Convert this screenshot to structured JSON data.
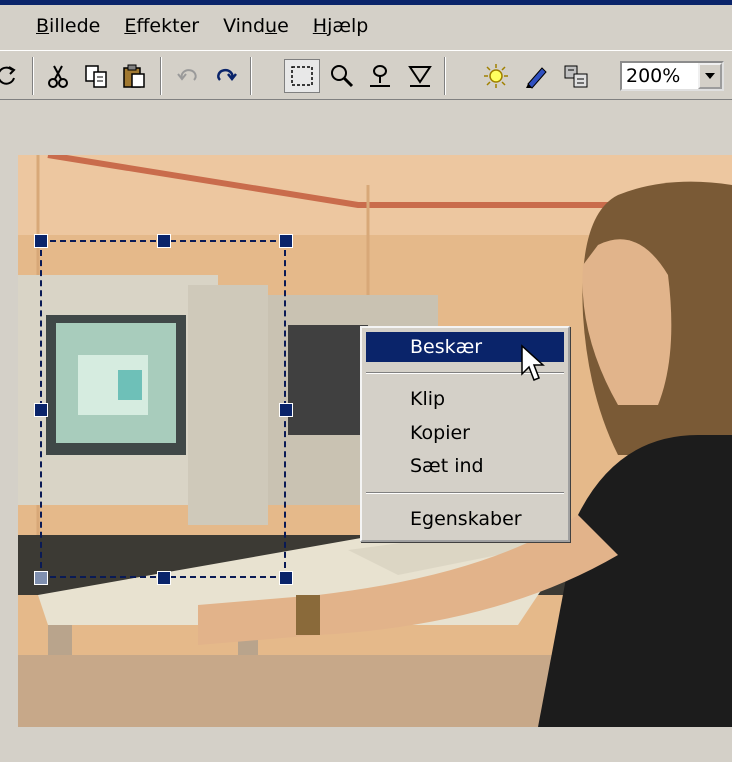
{
  "menubar": {
    "items": [
      {
        "label": "Billede",
        "u": "B",
        "rest": "illede"
      },
      {
        "label": "Effekter",
        "u": "E",
        "rest": "ffekter"
      },
      {
        "label": "Vindue",
        "pre": "Vind",
        "u": "u",
        "rest": "e"
      },
      {
        "label": "Hjælp",
        "u": "H",
        "rest": "jælp"
      }
    ]
  },
  "toolbar": {
    "icons": [
      "rotate-icon",
      "cut-icon",
      "copy-icon",
      "paste-icon",
      "undo-icon",
      "redo-icon",
      "select-rectangle-icon",
      "zoom-icon",
      "lasso-icon",
      "funnel-icon",
      "brightness-icon",
      "pencil-icon",
      "properties-icon"
    ],
    "zoom_value": "200%"
  },
  "context_menu": {
    "items": [
      "Beskær",
      "Klip",
      "Kopier",
      "Sæt ind",
      "Egenskaber"
    ],
    "highlighted": "Beskær"
  },
  "colors": {
    "menu_highlight": "#0a246a",
    "face": "#d4d0c8",
    "handle": "#0a246a"
  }
}
